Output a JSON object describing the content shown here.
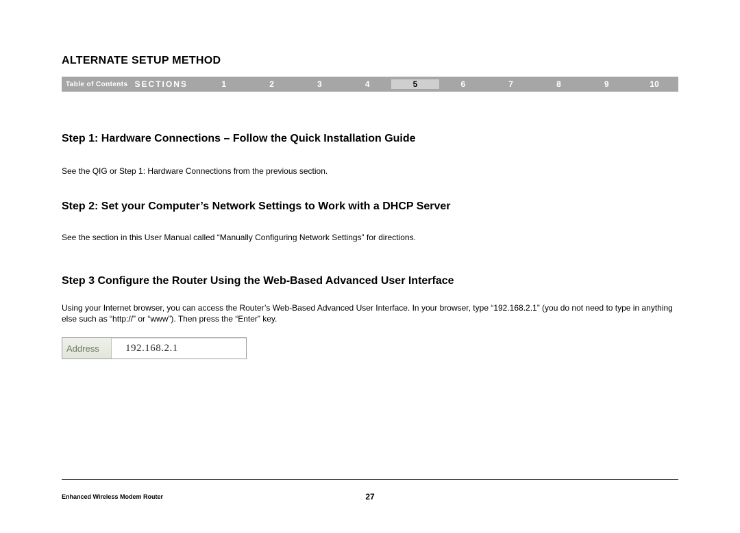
{
  "header": {
    "title": "ALTERNATE SETUP METHOD"
  },
  "navbar": {
    "toc": "Table of Contents",
    "sections_label": "SECTIONS",
    "numbers": [
      "1",
      "2",
      "3",
      "4",
      "5",
      "6",
      "7",
      "8",
      "9",
      "10"
    ],
    "selected_index": 4
  },
  "steps": {
    "s1": {
      "heading": "Step 1: Hardware Connections – Follow the Quick Installation Guide",
      "text": "See the QIG or Step 1: Hardware Connections from the previous section."
    },
    "s2": {
      "heading": "Step 2: Set your Computer’s Network Settings to Work with a DHCP Server",
      "text": "See the section in this User Manual called “Manually Configuring Network Settings” for directions."
    },
    "s3": {
      "heading": "Step 3 Configure the Router Using the Web-Based Advanced User Interface",
      "text": "Using your Internet browser, you can access the Router’s Web-Based Advanced User Interface. In your browser, type “192.168.2.1” (you do not need to type in anything else such as “http://” or “www”). Then press the “Enter” key."
    }
  },
  "address_bar": {
    "label": "Address",
    "value": "192.168.2.1"
  },
  "footer": {
    "product": "Enhanced Wireless Modem Router",
    "page_number": "27"
  }
}
